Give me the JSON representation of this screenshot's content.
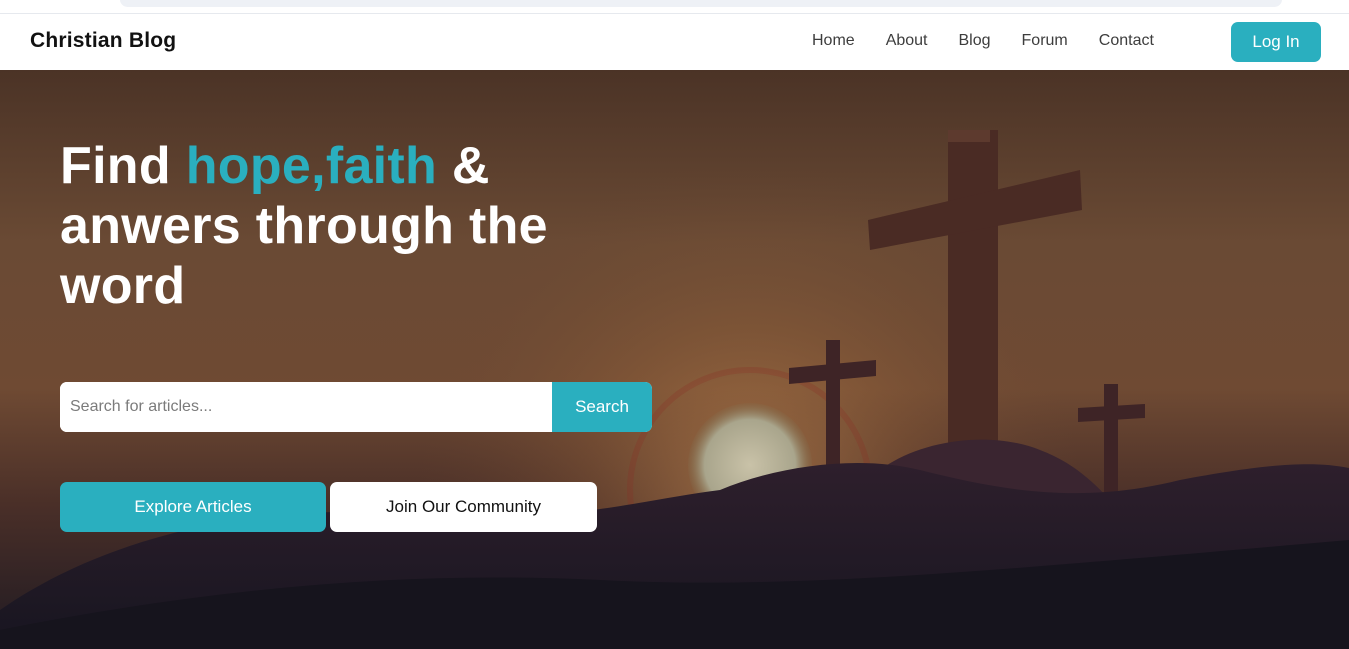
{
  "brand": {
    "name": "Christian Blog"
  },
  "nav": {
    "links": [
      "Home",
      "About",
      "Blog",
      "Forum",
      "Contact"
    ],
    "login_label": "Log In"
  },
  "hero": {
    "headline_prefix": "Find ",
    "headline_accent": "hope,faith",
    "headline_suffix": " & anwers through the word",
    "search_placeholder": "Search for articles...",
    "search_button": "Search",
    "primary_cta": "Explore Articles",
    "secondary_cta": "Join Our Community"
  },
  "colors": {
    "accent": "#2aafbf",
    "text_dark": "#111111",
    "white": "#ffffff"
  }
}
